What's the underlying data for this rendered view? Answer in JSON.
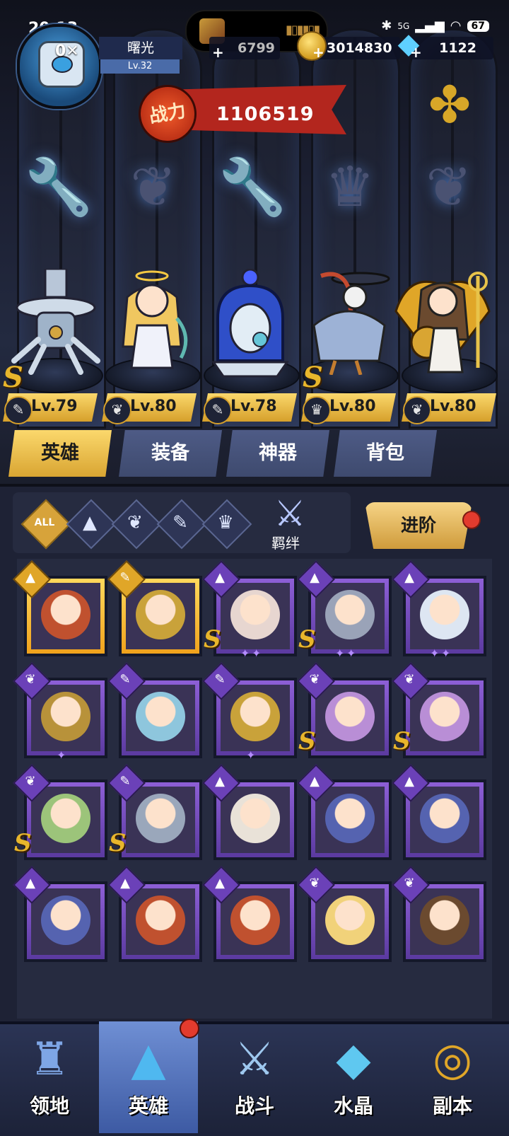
{
  "status_bar": {
    "time": "20:13",
    "battery": "67",
    "network": "5G"
  },
  "player": {
    "name": "曙光",
    "level": "Lv.32",
    "avatar_overlay": "0✕"
  },
  "currencies": {
    "left_partial": "6799",
    "gold": "3014830",
    "gems": "1122"
  },
  "power": {
    "label": "战力",
    "value": "1106519"
  },
  "lineup": {
    "slots": [
      {
        "class_icon": "wrench-icon",
        "level": "Lv.79",
        "rank": "S",
        "hero": "mech-spider"
      },
      {
        "class_icon": "wing-icon",
        "level": "Lv.80",
        "rank": "",
        "hero": "angel-archer"
      },
      {
        "class_icon": "wrench-icon",
        "level": "Lv.78",
        "rank": "",
        "hero": "capsule-ghost"
      },
      {
        "class_icon": "claw-icon",
        "level": "Lv.80",
        "rank": "S",
        "hero": "crane-mage"
      },
      {
        "class_icon": "wing-icon",
        "level": "Lv.80",
        "rank": "",
        "hero": "golden-goddess"
      }
    ]
  },
  "tabs": [
    {
      "label": "英雄",
      "active": true
    },
    {
      "label": "装备",
      "active": false
    },
    {
      "label": "神器",
      "active": false
    },
    {
      "label": "背包",
      "active": false
    }
  ],
  "filters": {
    "all_label": "ALL",
    "bond_label": "羁绊",
    "advance_label": "进阶"
  },
  "roster": [
    {
      "class": "mage",
      "frame": "gold",
      "rank": "",
      "stars": 0,
      "color": "#c0512f"
    },
    {
      "class": "wrench",
      "frame": "gold",
      "rank": "",
      "stars": 0,
      "color": "#c9a23a"
    },
    {
      "class": "mage",
      "frame": "purple",
      "rank": "S",
      "stars": 2,
      "color": "#e7d6d0"
    },
    {
      "class": "mage",
      "frame": "purple",
      "rank": "S",
      "stars": 2,
      "color": "#9aa3b8"
    },
    {
      "class": "mage",
      "frame": "purple",
      "rank": "",
      "stars": 2,
      "color": "#dde6f2"
    },
    {
      "class": "wing",
      "frame": "purple",
      "rank": "",
      "stars": 1,
      "color": "#b8923a"
    },
    {
      "class": "wrench",
      "frame": "purple",
      "rank": "",
      "stars": 0,
      "color": "#8ec6dd"
    },
    {
      "class": "wrench",
      "frame": "purple",
      "rank": "",
      "stars": 1,
      "color": "#c9a23a"
    },
    {
      "class": "wing",
      "frame": "purple",
      "rank": "S",
      "stars": 0,
      "color": "#b98ed6"
    },
    {
      "class": "wing",
      "frame": "purple",
      "rank": "S",
      "stars": 0,
      "color": "#b98ed6"
    },
    {
      "class": "wing",
      "frame": "purple",
      "rank": "S",
      "stars": 0,
      "color": "#9cc47a"
    },
    {
      "class": "wrench",
      "frame": "purple",
      "rank": "S",
      "stars": 0,
      "color": "#9aa7bb"
    },
    {
      "class": "mage",
      "frame": "purple",
      "rank": "",
      "stars": 0,
      "color": "#e9e2d8"
    },
    {
      "class": "mage",
      "frame": "purple",
      "rank": "",
      "stars": 0,
      "color": "#5563b0"
    },
    {
      "class": "mage",
      "frame": "purple",
      "rank": "",
      "stars": 0,
      "color": "#5563b0"
    },
    {
      "class": "mage",
      "frame": "purple",
      "rank": "",
      "stars": 0,
      "color": "#5563b0"
    },
    {
      "class": "mage",
      "frame": "purple",
      "rank": "",
      "stars": 0,
      "color": "#c0512f"
    },
    {
      "class": "mage",
      "frame": "purple",
      "rank": "",
      "stars": 0,
      "color": "#c0512f"
    },
    {
      "class": "wing",
      "frame": "purple",
      "rank": "",
      "stars": 0,
      "color": "#f1d27a"
    },
    {
      "class": "wing",
      "frame": "purple",
      "rank": "",
      "stars": 0,
      "color": "#6b4a2f"
    }
  ],
  "nav": [
    {
      "label": "领地",
      "icon": "castle-icon",
      "active": false
    },
    {
      "label": "英雄",
      "icon": "wizard-hat-icon",
      "active": true
    },
    {
      "label": "战斗",
      "icon": "sword-icon",
      "active": false
    },
    {
      "label": "水晶",
      "icon": "crystal-icon",
      "active": false
    },
    {
      "label": "副本",
      "icon": "portal-icon",
      "active": false
    }
  ],
  "colors": {
    "gold": "#d9a532",
    "purple_frame": "#7b4fc4",
    "panel": "#1e2235",
    "accent_red": "#b3261e"
  }
}
